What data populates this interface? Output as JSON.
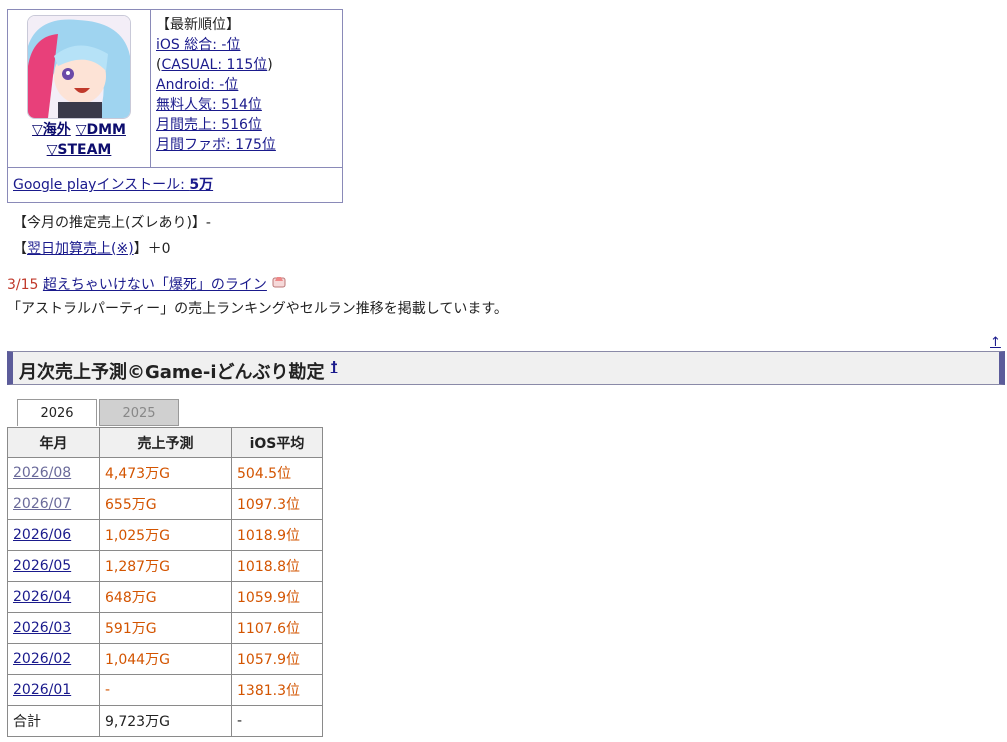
{
  "infobox": {
    "ranking_title": "【最新順位】",
    "ios_overall": "iOS 総合: -位",
    "casual_prefix": "(",
    "casual": "CASUAL: 115位",
    "casual_suffix": ")",
    "android": "Android: -位",
    "free_popularity": "無料人気: 514位",
    "monthly_sales": "月間売上: 516位",
    "monthly_fav": "月間ファボ: 175位",
    "link_overseas": "▽海外",
    "link_dmm": "▽DMM",
    "link_steam": "▽STEAM",
    "gp_install_label": "Google playインストール: ",
    "gp_install_value": "5万"
  },
  "estimate": {
    "this_month": "【今月の推定売上(ズレあり)】-",
    "next_day_prefix": "【",
    "next_day_link": "翌日加算売上(※)",
    "next_day_suffix": "】＋0"
  },
  "news": {
    "date": "3/15",
    "link": "超えちゃいけない「爆死」のライン"
  },
  "description": "「アストラルパーティー」の売上ランキングやセルラン推移を掲載しています。",
  "section": {
    "top_arrow": "↑",
    "title": "月次売上予測©Game-iどんぶり勘定",
    "title_mark": "†"
  },
  "tabs": [
    "2026",
    "2025"
  ],
  "table": {
    "headers": [
      "年月",
      "売上予測",
      "iOS平均"
    ],
    "rows": [
      {
        "month": "2026/08",
        "sales": "4,473万G",
        "ios": "504.5位"
      },
      {
        "month": "2026/07",
        "sales": "655万G",
        "ios": "1097.3位"
      },
      {
        "month": "2026/06",
        "sales": "1,025万G",
        "ios": "1018.9位"
      },
      {
        "month": "2026/05",
        "sales": "1,287万G",
        "ios": "1018.8位"
      },
      {
        "month": "2026/04",
        "sales": "648万G",
        "ios": "1059.9位"
      },
      {
        "month": "2026/03",
        "sales": "591万G",
        "ios": "1107.6位"
      },
      {
        "month": "2026/02",
        "sales": "1,044万G",
        "ios": "1057.9位"
      },
      {
        "month": "2026/01",
        "sales": "-",
        "ios": "1381.3位"
      }
    ],
    "total": {
      "label": "合計",
      "sales": "9,723万G",
      "ios": "-"
    }
  }
}
